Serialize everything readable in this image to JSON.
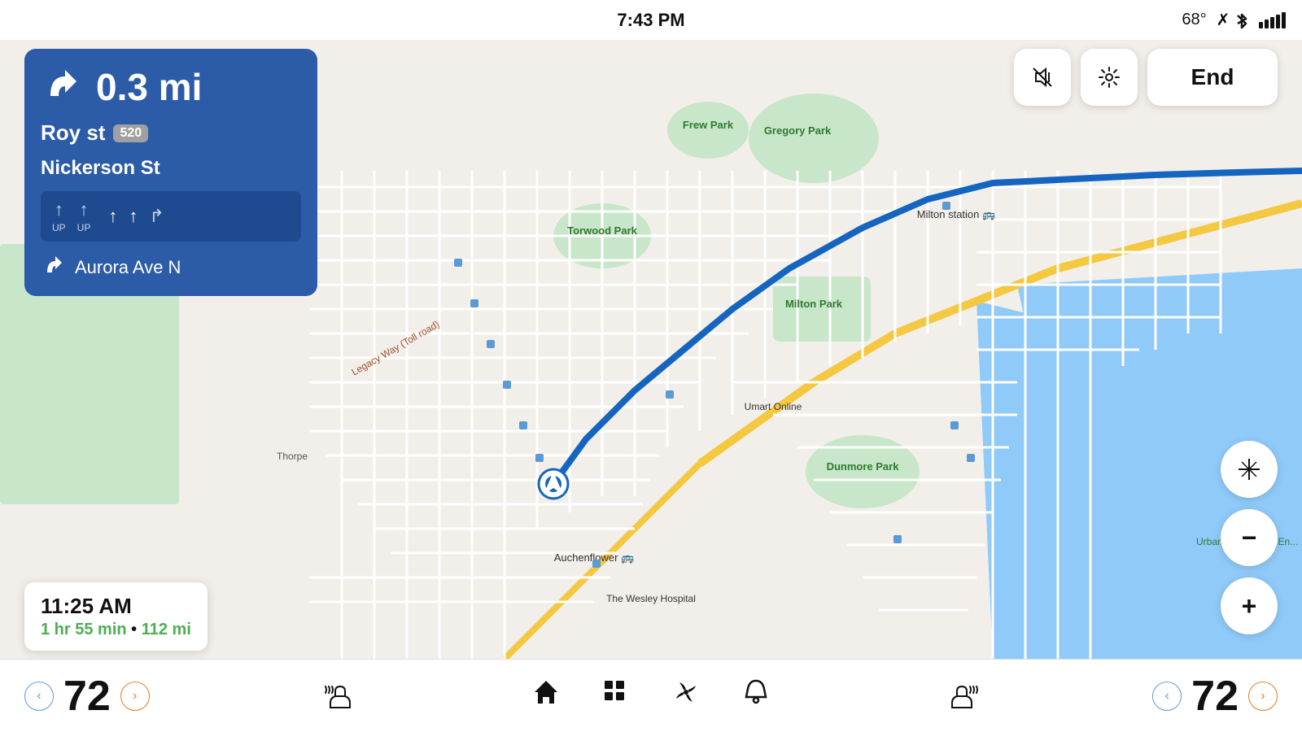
{
  "statusBar": {
    "time": "7:43 PM",
    "temperature": "68°",
    "bluetooth": "BT",
    "signal": "signal"
  },
  "navigation": {
    "distance": "0.3 mi",
    "street": "Roy st",
    "routeNumber": "520",
    "street2": "Nickerson St",
    "nextStreet": "Aurora Ave N",
    "lanes": [
      {
        "direction": "UP",
        "label": "UP",
        "active": false
      },
      {
        "direction": "UP",
        "label": "UP",
        "active": false
      },
      {
        "direction": "↑",
        "label": "",
        "active": true
      },
      {
        "direction": "↑",
        "label": "",
        "active": true
      },
      {
        "direction": "↱",
        "label": "",
        "active": false
      }
    ]
  },
  "eta": {
    "arrivalTime": "11:25 AM",
    "duration": "1 hr 55 min",
    "distance": "112 mi"
  },
  "controls": {
    "volumeLabel": "🔇",
    "settingsLabel": "⚙",
    "endLabel": "End",
    "moveLabel": "⤢",
    "zoomOutLabel": "−",
    "zoomInLabel": "+"
  },
  "bottomBar": {
    "leftTemp": "72",
    "leftTempDecrement": "<",
    "leftTempIncrement": ">",
    "heatSeatLeft": "heat-seat-left",
    "homeLabel": "🏠",
    "gridLabel": "⊞",
    "fanLabel": "fan",
    "bellLabel": "🔔",
    "heatSeatRight": "heat-seat-right",
    "rightTemp": "72",
    "rightTempDecrement": "<",
    "rightTempIncrement": ">"
  },
  "mapLabels": {
    "gregoryPark": "Gregory Park",
    "torwoodPark": "Torwood Park",
    "miltonStation": "Milton station",
    "miltonPark": "Milton Park",
    "dunmorePark": "Dunmore Park",
    "frewPark": "Frew Park",
    "auchenflower": "Auchenflower",
    "umart": "Umart Online",
    "wesleyHospital": "The Wesley Hospital",
    "urbanClimb": "Urban Climb West En...",
    "legacyWay": "Legacy Way (Toll road)",
    "thorpe": "Thorpe"
  }
}
